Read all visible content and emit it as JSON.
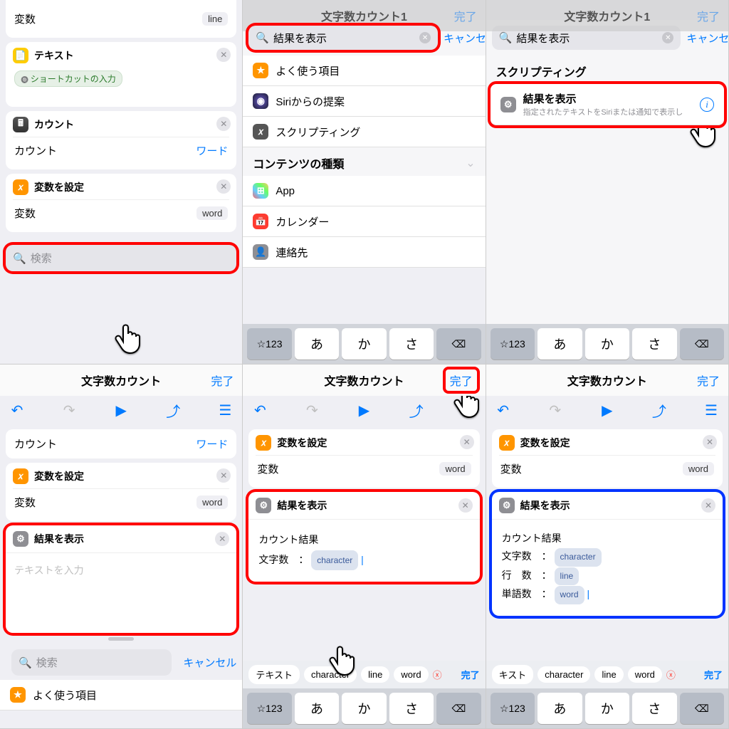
{
  "common": {
    "done": "完了",
    "cancel": "キャンセル",
    "search": "検索",
    "title": "文字数カウント",
    "titlePartial": "文字数カウント1"
  },
  "actions": {
    "text": "テキスト",
    "shortcutInput": "ショートカットの入力",
    "count": "カウント",
    "setVar": "変数を設定",
    "variable": "変数",
    "showResult": "結果を表示",
    "word": "ワード"
  },
  "vals": {
    "line": "line",
    "word": "word",
    "character": "character"
  },
  "p2": {
    "query": "結果を表示",
    "favorites": "よく使う項目",
    "siri": "Siriからの提案",
    "scripting": "スクリプティング",
    "contentTypes": "コンテンツの種類",
    "app": "App",
    "calendar": "カレンダー",
    "contacts": "連絡先"
  },
  "p3": {
    "scripting": "スクリプティング",
    "showResult": "結果を表示",
    "sub": "指定されたテキストをSiriまたは通知で表示し"
  },
  "p4": {
    "placeholder": "テキストを入力",
    "favorites": "よく使う項目"
  },
  "p5": {
    "countResult": "カウント結果",
    "charLabel": "文字数　：",
    "chips": {
      "text": "テキスト",
      "char": "character",
      "line": "line",
      "word": "word"
    }
  },
  "p6": {
    "countResult": "カウント結果",
    "charLabel": "文字数　：",
    "lineLabel": "行　数　：",
    "wordLabel": "単語数　：",
    "chips": {
      "kst": "キスト"
    }
  },
  "kb": {
    "num": "☆123",
    "a": "あ",
    "ka": "か",
    "sa": "さ",
    "bs": "⌫"
  }
}
